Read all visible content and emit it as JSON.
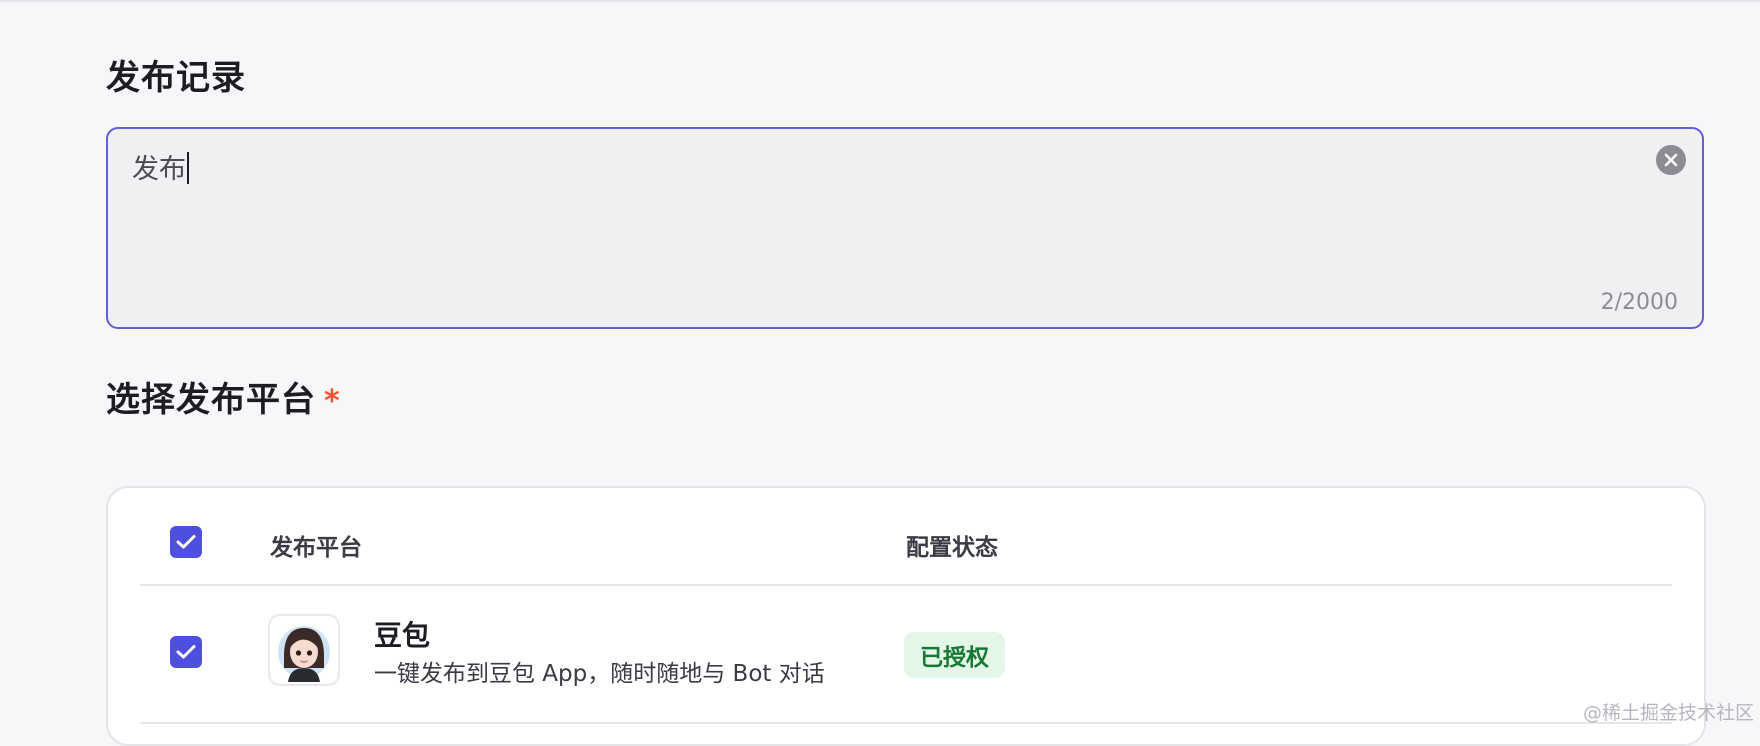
{
  "record_section": {
    "title": "发布记录",
    "input_value": "发布",
    "char_counter": "2/2000"
  },
  "platform_section": {
    "title": "选择发布平台",
    "required_marker": "*"
  },
  "table": {
    "headers": {
      "platform": "发布平台",
      "status": "配置状态"
    },
    "rows": [
      {
        "name": "豆包",
        "description": "一键发布到豆包 App，随时随地与 Bot 对话",
        "status": "已授权",
        "checked": true
      }
    ]
  },
  "watermark": "@稀土掘金技术社区",
  "icons": {
    "clear": "clear-circle-icon",
    "check": "checkmark-icon",
    "logo": "doubao-avatar-logo"
  },
  "colors": {
    "accent": "#4e4fe0",
    "input_border": "#5f5fd8",
    "required": "#f0522f",
    "status_bg": "#e3f6e8",
    "status_text": "#177a34"
  }
}
